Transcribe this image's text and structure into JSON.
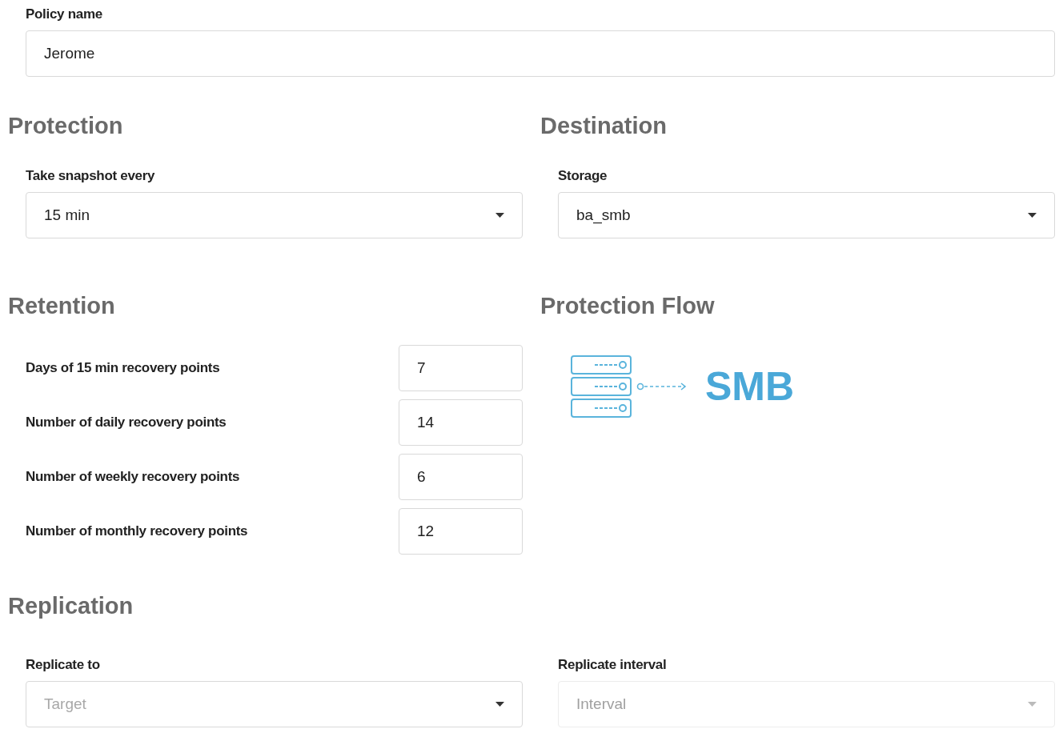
{
  "policy_name": {
    "label": "Policy name",
    "value": "Jerome"
  },
  "protection": {
    "title": "Protection",
    "snapshot": {
      "label": "Take snapshot every",
      "value": "15 min",
      "disabled": false
    }
  },
  "destination": {
    "title": "Destination",
    "storage": {
      "label": "Storage",
      "value": "ba_smb",
      "disabled": false
    }
  },
  "retention": {
    "title": "Retention",
    "rows": [
      {
        "label": "Days of 15 min recovery points",
        "value": "7"
      },
      {
        "label": "Number of daily recovery points",
        "value": "14"
      },
      {
        "label": "Number of weekly recovery points",
        "value": "6"
      },
      {
        "label": "Number of monthly recovery points",
        "value": "12"
      }
    ]
  },
  "protection_flow": {
    "title": "Protection Flow",
    "target": "SMB"
  },
  "replication": {
    "title": "Replication",
    "fields": [
      {
        "label": "Replicate to",
        "placeholder": "Target",
        "disabled": false
      },
      {
        "label": "Replicate interval",
        "placeholder": "Interval",
        "disabled": true
      }
    ]
  }
}
